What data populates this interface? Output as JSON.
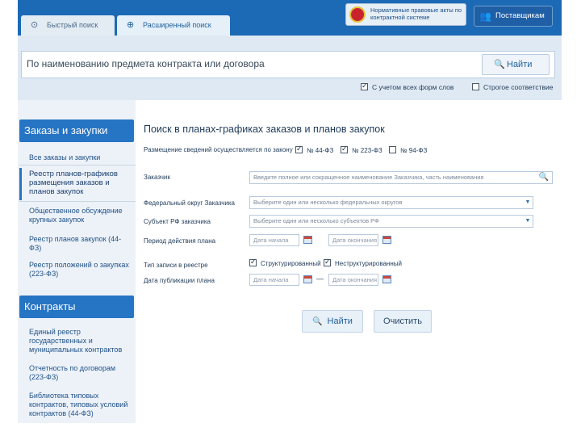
{
  "header": {
    "tabs": [
      {
        "label": "Быстрый поиск"
      },
      {
        "label": "Расширенный поиск"
      }
    ],
    "normative_link": "Нормативные правовые акты по контрактной системе",
    "suppliers_label": "Поставщикам"
  },
  "search": {
    "placeholder": "По наименованию предмета контракта или договора",
    "find_label": "Найти",
    "options": [
      {
        "label": "С учетом всех форм слов",
        "checked": true
      },
      {
        "label": "Строгое соответствие",
        "checked": false
      }
    ]
  },
  "sidebar": {
    "section1": {
      "title": "Заказы и закупки",
      "items": [
        "Все заказы и закупки",
        "Реестр планов-графиков размещения заказов и планов закупок",
        "Общественное обсуждение крупных закупок",
        "Реестр планов закупок (44-ФЗ)",
        "Реестр положений о закупках (223-ФЗ)"
      ]
    },
    "section2": {
      "title": "Контракты",
      "items": [
        "Единый реестр государственных и муниципальных контрактов",
        "Отчетность по договорам (223-ФЗ)",
        "Библиотека типовых контрактов, типовых условий контрактов (44-ФЗ)"
      ]
    }
  },
  "form": {
    "title": "Поиск в планах-графиках заказов и планов закупок",
    "law_label": "Размещение сведений осуществляется по закону",
    "laws": [
      {
        "label": "№ 44-ФЗ",
        "checked": true
      },
      {
        "label": "№ 223-ФЗ",
        "checked": true
      },
      {
        "label": "№ 94-ФЗ",
        "checked": false
      }
    ],
    "customer_label": "Заказчик",
    "customer_placeholder": "Введите полное или сокращенное наименование Заказчика, часть наименования",
    "district_label": "Федеральный округ Заказчика",
    "district_placeholder": "Выберите один или несколько федеральных округов",
    "subject_label": "Субъект РФ заказчика",
    "subject_placeholder": "Выберите один или несколько субъектов РФ",
    "period_label": "Период действия плана",
    "date_start": "Дата начала",
    "date_end": "Дата окончания",
    "record_type_label": "Тип записи в реестре",
    "record_types": [
      {
        "label": "Структурированный",
        "checked": true
      },
      {
        "label": "Неструктурированный",
        "checked": true
      }
    ],
    "publish_label": "Дата публикации плана",
    "publish_dash": "—",
    "find_label": "Найти",
    "clear_label": "Очистить"
  }
}
